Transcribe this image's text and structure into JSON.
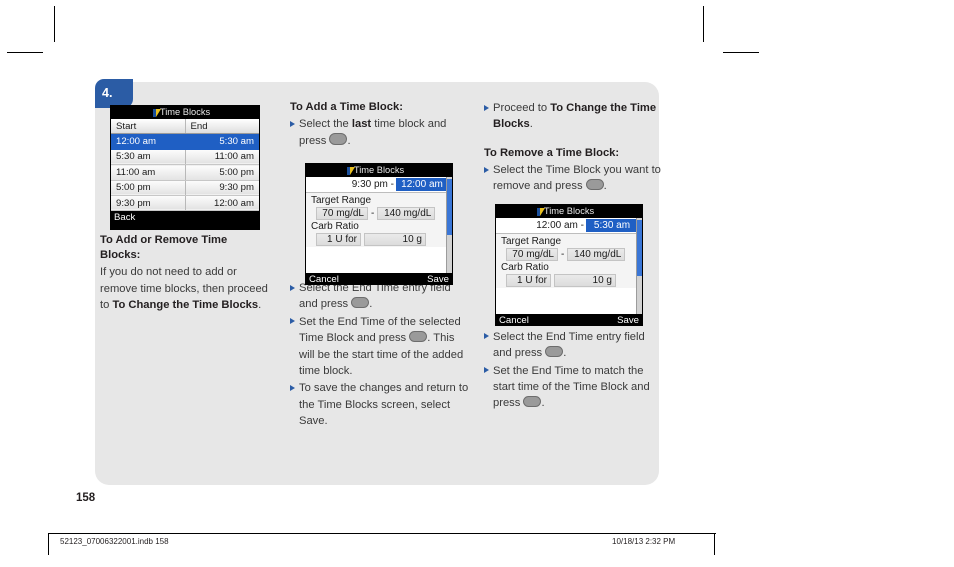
{
  "page": {
    "step_number": "4.",
    "page_number": "158",
    "footer_left": "52123_07006322001.indb   158",
    "footer_right": "10/18/13   2:32 PM"
  },
  "colors": {
    "accent_blue": "#2b5ca5",
    "selection_blue": "#1f5fc4",
    "panel_gray": "#e7e7e7",
    "device_black": "#000000"
  },
  "screen_time_blocks_list": {
    "title": "Time Blocks",
    "logo_icon": "time-blocks-logo-icon",
    "columns": [
      "Start",
      "End"
    ],
    "rows": [
      {
        "start": "12:00 am",
        "end": "5:30 am",
        "selected": true
      },
      {
        "start": "5:30 am",
        "end": "11:00 am",
        "selected": false
      },
      {
        "start": "11:00 am",
        "end": "5:00 pm",
        "selected": false
      },
      {
        "start": "5:00 pm",
        "end": "9:30 pm",
        "selected": false
      },
      {
        "start": "9:30 pm",
        "end": "12:00 am",
        "selected": false
      }
    ],
    "footer_left": "Back"
  },
  "screen_add_block": {
    "title": "Time Blocks",
    "start_time": "9:30 pm -",
    "end_time": "12:00 am",
    "target_range_label": "Target Range",
    "target_low": "70 mg/dL",
    "target_dash": "-",
    "target_high": "140 mg/dL",
    "carb_ratio_label": "Carb Ratio",
    "carb_units": "1 U for",
    "carb_grams": "10 g",
    "footer_left": "Cancel",
    "footer_right": "Save"
  },
  "screen_remove_block": {
    "title": "Time Blocks",
    "start_time": "12:00 am -",
    "end_time": "5:30 am",
    "target_range_label": "Target Range",
    "target_low": "70 mg/dL",
    "target_dash": "-",
    "target_high": "140 mg/dL",
    "carb_ratio_label": "Carb Ratio",
    "carb_units": "1 U for",
    "carb_grams": "10 g",
    "footer_left": "Cancel",
    "footer_right": "Save"
  },
  "column_1": {
    "heading": "To Add or Remove Time Blocks:",
    "body_part_1": "If you do not need to add or remove time blocks, then proceed to ",
    "body_bold": "To Change the Time Blocks",
    "body_part_2": "."
  },
  "column_2": {
    "heading": "To Add a Time Block:",
    "bullet_1_part_1": "Select the ",
    "bullet_1_bold": "last",
    "bullet_1_part_2": " time block and press ",
    "bullet_1_part_3": ".",
    "bullet_2_part_1": "Select the End Time entry field and press ",
    "bullet_2_part_2": ".",
    "bullet_3_part_1": "Set the End Time of the selected Time Block and press ",
    "bullet_3_part_2": ". This will be the start time of the added time block.",
    "bullet_4": "To save the changes and return to the Time Blocks screen, select Save."
  },
  "column_3": {
    "bullet_1_part_1": "Proceed to ",
    "bullet_1_bold": "To Change the Time Blocks",
    "bullet_1_part_2": ".",
    "heading": "To Remove a Time Block:",
    "bullet_2_part_1": "Select the Time Block you want to remove and press ",
    "bullet_2_part_2": ".",
    "bullet_3_part_1": "Select the End Time entry field and press ",
    "bullet_3_part_2": ".",
    "bullet_4_part_1": "Set the End Time to match the start time of the Time Block and press ",
    "bullet_4_part_2": "."
  }
}
